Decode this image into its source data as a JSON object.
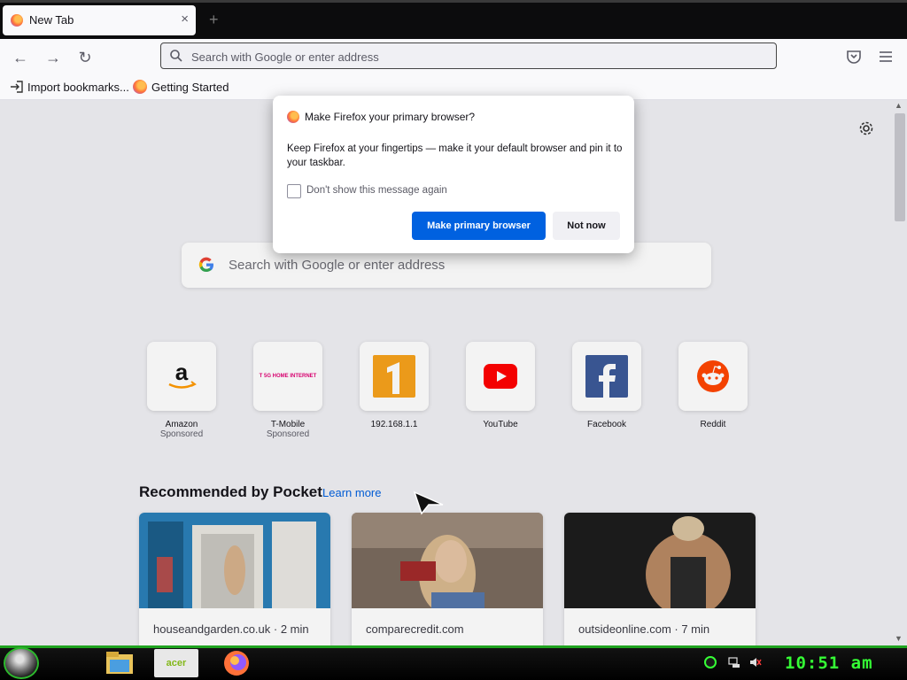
{
  "browser": {
    "tab_title": "New Tab",
    "tab_close": "×",
    "new_tab": "+",
    "url_placeholder": "Search with Google or enter address"
  },
  "bookmarks": [
    {
      "label": "Import bookmarks...",
      "icon": "import-icon"
    },
    {
      "label": "Getting Started",
      "icon": "firefox-icon"
    }
  ],
  "newtab": {
    "search_placeholder": "Search with Google or enter address",
    "shortcuts": [
      {
        "name": "Amazon",
        "sponsored": "Sponsored",
        "icon": "amazon-logo"
      },
      {
        "name": "T-Mobile",
        "sponsored": "Sponsored",
        "icon": "tmobile-logo",
        "logo_text": "T 5G HOME INTERNET"
      },
      {
        "name": "192.168.1.1",
        "sponsored": "",
        "icon": "router-logo"
      },
      {
        "name": "YouTube",
        "sponsored": "",
        "icon": "youtube-logo"
      },
      {
        "name": "Facebook",
        "sponsored": "",
        "icon": "facebook-logo"
      },
      {
        "name": "Reddit",
        "sponsored": "",
        "icon": "reddit-logo"
      }
    ],
    "pocket_header": "Recommended by Pocket",
    "learn_more": "Learn more",
    "stories": [
      {
        "source": "houseandgarden.co.uk · 2 min"
      },
      {
        "source": "comparecredit.com"
      },
      {
        "source": "outsideonline.com · 7 min"
      }
    ]
  },
  "dialog": {
    "title": "Make Firefox your primary browser?",
    "body": "Keep Firefox at your fingertips — make it your default browser and pin it to your taskbar.",
    "checkbox_label": "Don't show this message again",
    "primary_button": "Make primary browser",
    "secondary_button": "Not now"
  },
  "taskbar": {
    "clock": "10:51 am",
    "apps": [
      "file-explorer-icon",
      "acer-icon",
      "firefox-icon"
    ],
    "app_label_acer": "acer"
  },
  "colors": {
    "accent": "#0061e0",
    "taskbar_green": "#35ff35"
  }
}
